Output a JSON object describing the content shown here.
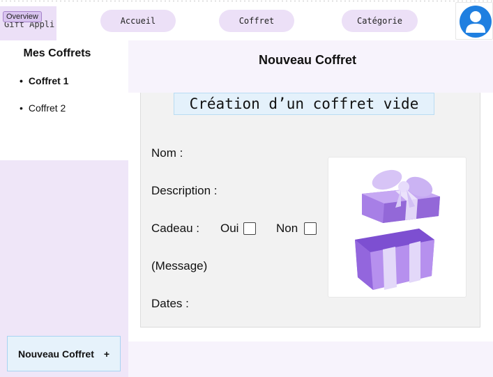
{
  "header": {
    "brand": "Gift Appli",
    "overview_badge": "Overview",
    "nav": {
      "accueil": "Accueil",
      "coffret": "Coffret",
      "categorie": "Catégorie"
    }
  },
  "sidebar": {
    "title": "Mes Coffrets",
    "items": [
      {
        "label": "Coffret 1",
        "active": true
      },
      {
        "label": "Coffret 2",
        "active": false
      }
    ],
    "new_button": {
      "label": "Nouveau Coffret",
      "plus": "+"
    }
  },
  "main": {
    "title": "Nouveau Coffret",
    "form_heading": "Création d’un coffret vide",
    "fields": {
      "nom": "Nom :",
      "description": "Description :",
      "cadeau": "Cadeau  :",
      "oui": "Oui",
      "non": "Non",
      "message": "(Message)",
      "dates": "Dates :"
    },
    "image_icon": "gift-box-illustration"
  },
  "colors": {
    "lavender": "#ece0f7",
    "sidebar_bg": "#efe6f8",
    "header_bg": "#f7f3fc",
    "accent_blue": "#1f7fe0",
    "gift_purple": "#a77fe6"
  }
}
